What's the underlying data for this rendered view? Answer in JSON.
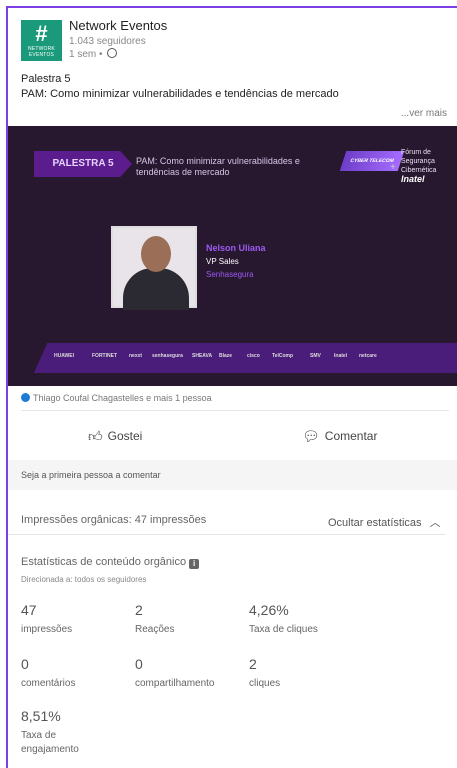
{
  "post": {
    "author": "Network Eventos",
    "logo_text": "NETWORK EVENTOS",
    "followers": "1.043 seguidores",
    "time": "1 sem •",
    "line1": "Palestra 5",
    "line2": "PAM: Como minimizar vulnerabilidades e tendências de mercado",
    "see_more": "...ver mais"
  },
  "banner": {
    "tag": "PALESTRA 5",
    "subtitle": "PAM: Como minimizar vulnerabilidades e tendências de mercado",
    "cyber": "CYBER TELECOM",
    "forum_lines": [
      "Fórum de",
      "Segurança",
      "Cibernética"
    ],
    "forum_brand": "Inatel",
    "speaker_name": "Nelson Uliana",
    "speaker_role": "VP Sales",
    "speaker_company": "Senhasegura",
    "sponsors": [
      "HUAWEI",
      "FORTINET",
      "nexxt",
      "senhasegura",
      "SHEAVA",
      "Blaze",
      "cisco",
      "TelComp",
      "SMV",
      "Inatel",
      "netcare"
    ]
  },
  "reactions": "Thiago Coufal Chagastelles e mais 1 pessoa",
  "actions": {
    "like": "Gostei",
    "comment": "Comentar"
  },
  "first_comment": "Seja a primeira pessoa a comentar",
  "impressions_line": "Impressões orgânicas: 47 impressões",
  "hide_stats": "Ocultar estatísticas",
  "stats": {
    "title": "Estatísticas de conteúdo orgânico",
    "subtitle": "Direcionada a: todos os seguidores",
    "items": [
      {
        "value": "47",
        "label": "impressões"
      },
      {
        "value": "2",
        "label": "Reações"
      },
      {
        "value": "4,26%",
        "label": "Taxa de cliques"
      },
      {
        "value": "0",
        "label": "comentários"
      },
      {
        "value": "0",
        "label": "compartilhamento"
      },
      {
        "value": "2",
        "label": "cliques"
      },
      {
        "value": "8,51%",
        "label": "Taxa de engajamento"
      }
    ]
  }
}
